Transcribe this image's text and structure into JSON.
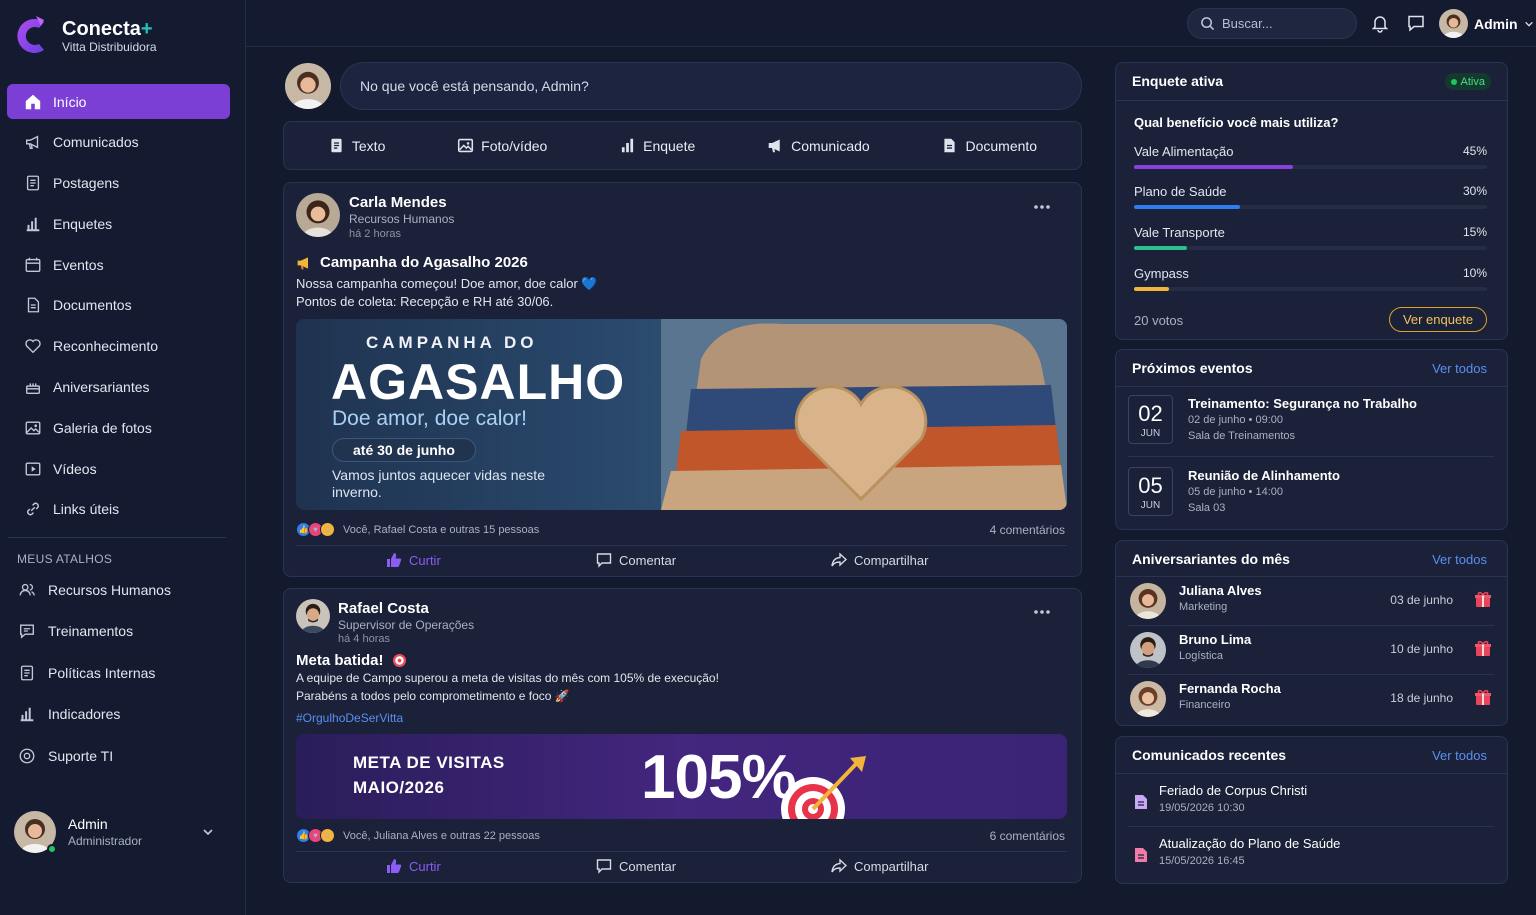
{
  "brand": {
    "name": "Conecta",
    "plus": "+",
    "company": "Vitta Distribuidora"
  },
  "nav": [
    {
      "label": "Início",
      "icon": "home-icon",
      "active": true
    },
    {
      "label": "Comunicados",
      "icon": "megaphone-icon"
    },
    {
      "label": "Postagens",
      "icon": "document-icon"
    },
    {
      "label": "Enquetes",
      "icon": "bar-chart-icon"
    },
    {
      "label": "Eventos",
      "icon": "calendar-icon"
    },
    {
      "label": "Documentos",
      "icon": "file-icon"
    },
    {
      "label": "Reconhecimento",
      "icon": "heart-icon"
    },
    {
      "label": "Aniversariantes",
      "icon": "cake-icon"
    },
    {
      "label": "Galeria de fotos",
      "icon": "image-icon"
    },
    {
      "label": "Vídeos",
      "icon": "play-icon"
    },
    {
      "label": "Links úteis",
      "icon": "link-icon"
    }
  ],
  "shortcuts": {
    "title": "MEUS ATALHOS",
    "items": [
      {
        "label": "Recursos Humanos",
        "icon": "users-icon"
      },
      {
        "label": "Treinamentos",
        "icon": "chat-icon"
      },
      {
        "label": "Políticas Internas",
        "icon": "document-icon"
      },
      {
        "label": "Indicadores",
        "icon": "bar-chart-icon"
      },
      {
        "label": "Suporte TI",
        "icon": "support-icon"
      }
    ]
  },
  "sidebar_user": {
    "name": "Admin",
    "role": "Administrador"
  },
  "topbar": {
    "search_placeholder": "Buscar...",
    "user": "Admin"
  },
  "composer": {
    "placeholder": "No que você está pensando, Admin?"
  },
  "post_actions": [
    "Texto",
    "Foto/vídeo",
    "Enquete",
    "Comunicado",
    "Documento"
  ],
  "posts": [
    {
      "author": "Carla Mendes",
      "role": "Recursos Humanos",
      "time": "há 2 horas",
      "title": "Campanha do Agasalho 2026",
      "text": [
        "Nossa campanha começou! Doe amor, doe calor 💙",
        "Pontos de coleta: Recepção e RH até 30/06."
      ],
      "banner": {
        "kicker": "CAMPANHA DO",
        "title": "AGASALHO",
        "subtitle": "Doe amor, doe calor!",
        "pill": "até 30 de junho",
        "footer": "Vamos juntos aquecer vidas neste inverno."
      },
      "reactions": "Você, Rafael Costa e outras 15 pessoas",
      "comments": "4 comentários"
    },
    {
      "author": "Rafael Costa",
      "role": "Supervisor de Operações",
      "time": "há 4 horas",
      "title": "Meta batida!",
      "text": [
        "A equipe de Campo superou a meta de visitas do mês com 105% de execução!",
        "Parabéns a todos pelo comprometimento e foco 🚀"
      ],
      "hashtag": "#OrgulhoDeSerVitta",
      "banner": {
        "title": "META DE VISITAS MAIO/2026",
        "value": "105%"
      },
      "reactions": "Você, Juliana Alves e outras 22 pessoas",
      "comments": "6 comentários"
    }
  ],
  "post_buttons": {
    "like": "Curtir",
    "comment": "Comentar",
    "share": "Compartilhar"
  },
  "poll": {
    "header": "Enquete ativa",
    "status": "Ativa",
    "question": "Qual benefício você mais utiliza?",
    "options": [
      {
        "label": "Vale Alimentação",
        "pct": "45%",
        "value": 0.45,
        "color": "#8b3fe0"
      },
      {
        "label": "Plano de Saúde",
        "pct": "30%",
        "value": 0.3,
        "color": "#2b7ff0"
      },
      {
        "label": "Vale Transporte",
        "pct": "15%",
        "value": 0.15,
        "color": "#2fbf8f"
      },
      {
        "label": "Gympass",
        "pct": "10%",
        "value": 0.1,
        "color": "#f2b43a"
      }
    ],
    "votes": "20 votos",
    "button": "Ver enquete"
  },
  "events": {
    "header": "Próximos eventos",
    "link": "Ver todos",
    "items": [
      {
        "day": "02",
        "month": "JUN",
        "title": "Treinamento: Segurança no Trabalho",
        "when": "02 de junho • 09:00",
        "where": "Sala de Treinamentos"
      },
      {
        "day": "05",
        "month": "JUN",
        "title": "Reunião de Alinhamento",
        "when": "05 de junho • 14:00",
        "where": "Sala 03"
      }
    ]
  },
  "birthdays": {
    "header": "Aniversariantes do mês",
    "link": "Ver todos",
    "items": [
      {
        "name": "Juliana Alves",
        "dept": "Marketing",
        "date": "03 de junho"
      },
      {
        "name": "Bruno Lima",
        "dept": "Logística",
        "date": "10 de junho"
      },
      {
        "name": "Fernanda Rocha",
        "dept": "Financeiro",
        "date": "18 de junho"
      }
    ]
  },
  "announcements": {
    "header": "Comunicados recentes",
    "link": "Ver todos",
    "items": [
      {
        "title": "Feriado de Corpus Christi",
        "date": "19/05/2026 10:30"
      },
      {
        "title": "Atualização do Plano de Saúde",
        "date": "15/05/2026 16:45"
      }
    ]
  },
  "colors": {
    "accent": "#7b3fd6",
    "link": "#5b8ff0",
    "bg": "#131a2e",
    "card": "#1a2138"
  }
}
